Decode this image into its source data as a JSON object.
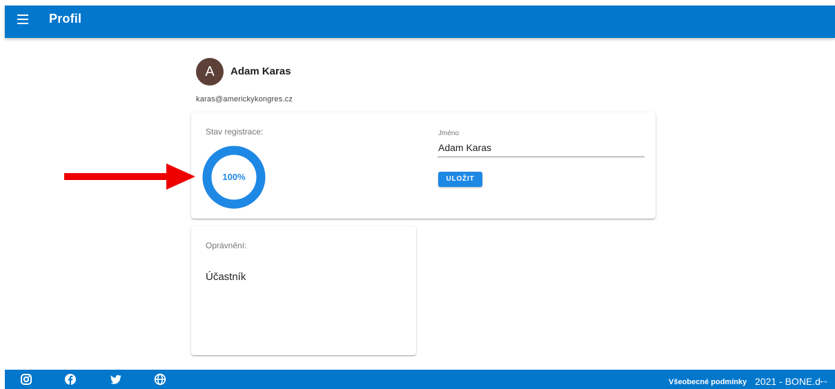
{
  "appbar": {
    "title": "Profil",
    "menu_icon": "menu-icon",
    "color": "#0277cc"
  },
  "user": {
    "avatar_letter": "A",
    "name": "Adam Karas",
    "email": "karas@americkykongres.cz",
    "avatar_color": "#5d4037"
  },
  "registration": {
    "label": "Stav registrace:",
    "progress_percent": 100,
    "progress_text": "100%",
    "progress_color": "#1e88e5"
  },
  "form": {
    "name_label": "Jméno",
    "name_value": "Adam Karas",
    "save_label": "ULOŽIT"
  },
  "permissions": {
    "label": "Oprávnění:",
    "value": "Účastník"
  },
  "annotation": {
    "arrow_color": "#ee0000"
  },
  "footer": {
    "icons": [
      "instagram-icon",
      "facebook-icon",
      "twitter-icon",
      "globe-icon"
    ],
    "terms_link": "Všeobecné podmínky",
    "copyright": "2021 - BONE.d"
  }
}
